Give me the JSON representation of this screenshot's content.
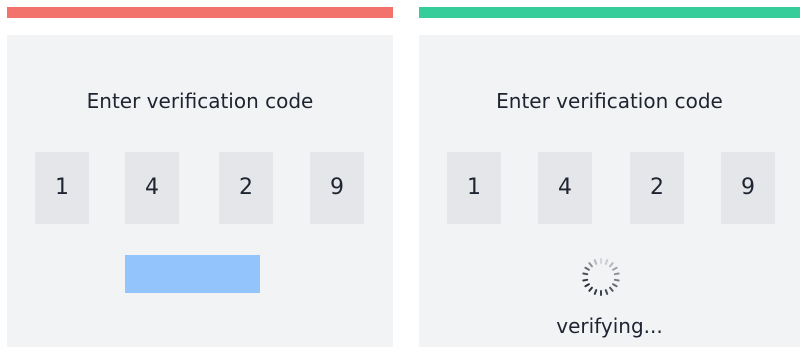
{
  "colors": {
    "error_bar": "#f2736b",
    "success_bar": "#35ce9a",
    "button_fill": "#93c4fc",
    "card_bg": "#f2f3f5",
    "digit_bg": "#e4e6ea"
  },
  "left_panel": {
    "title": "Enter verification code",
    "digits": [
      "1",
      "4",
      "2",
      "9"
    ],
    "submit_button_label": ""
  },
  "right_panel": {
    "title": "Enter verification code",
    "digits": [
      "1",
      "4",
      "2",
      "9"
    ],
    "status": "verifying...",
    "spinner_icon": "loading-spinner-icon"
  }
}
